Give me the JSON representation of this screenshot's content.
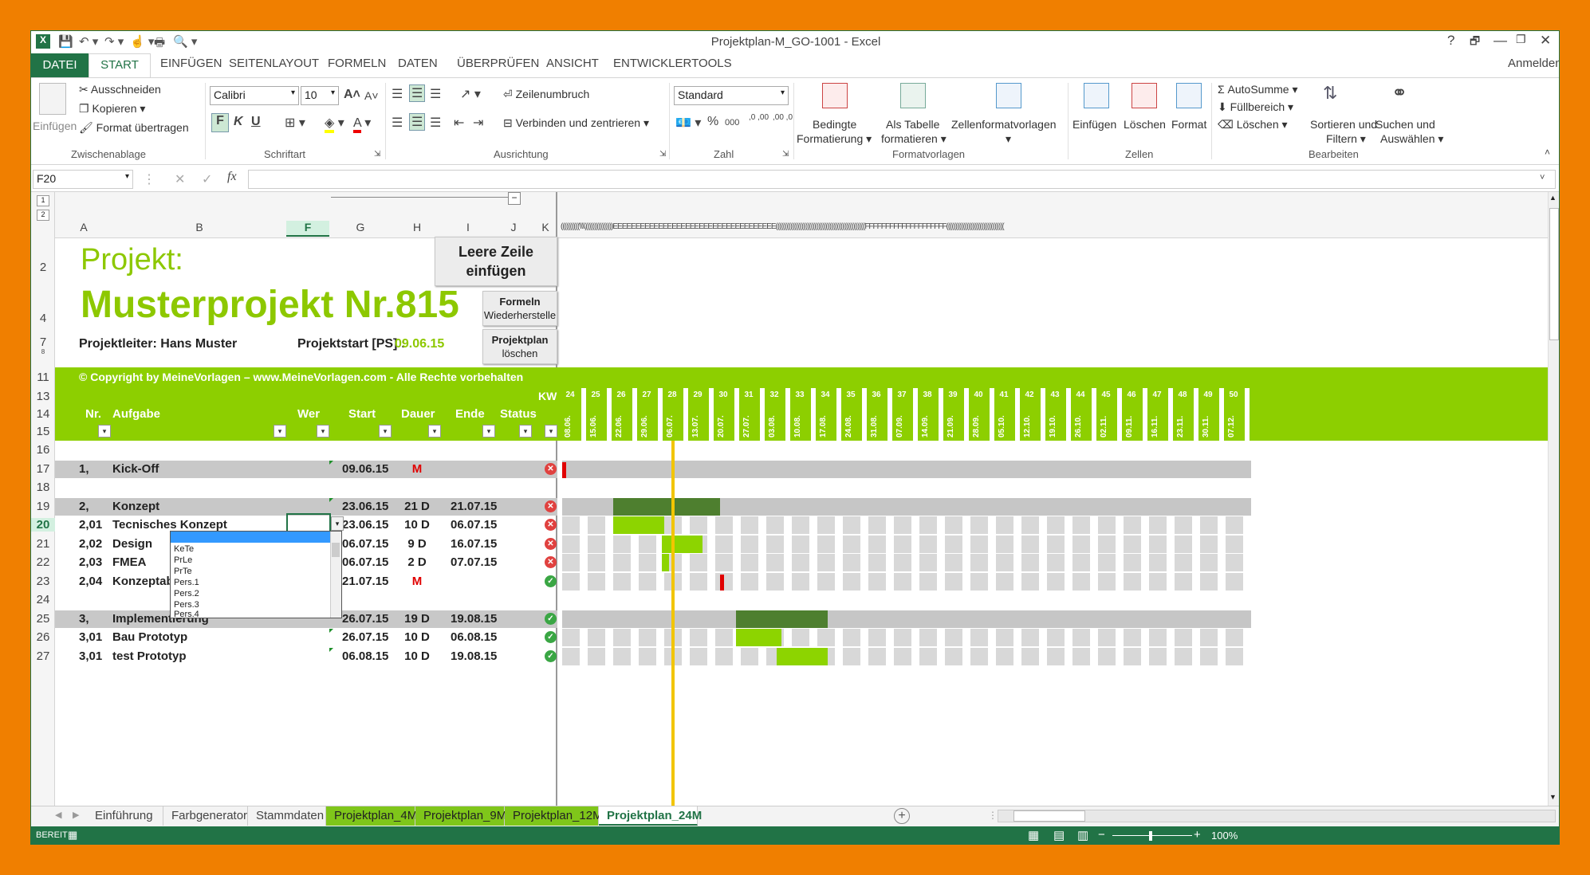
{
  "title": "Projektplan-M_GO-1001 - Excel",
  "window": {
    "help": "?",
    "restore": "🗗",
    "minimize": "🗕",
    "maximize": "🗖",
    "close": "✕"
  },
  "tabs": {
    "file": "DATEI",
    "start": "START",
    "items": [
      "EINFÜGEN",
      "SEITENLAYOUT",
      "FORMELN",
      "DATEN",
      "ÜBERPRÜFEN",
      "ANSICHT",
      "ENTWICKLERTOOLS"
    ],
    "signin": "Anmelden"
  },
  "ribbon": {
    "paste": "Einfügen",
    "cut": "Ausschneiden",
    "copy": "Kopieren",
    "format_painter": "Format übertragen",
    "g_clipboard": "Zwischenablage",
    "font": "Calibri",
    "size": "10",
    "g_font": "Schriftart",
    "bold": "F",
    "italic": "K",
    "underline": "U",
    "wrap": "Zeilenumbruch",
    "merge": "Verbinden und zentrieren",
    "g_align": "Ausrichtung",
    "numfmt": "Standard",
    "g_number": "Zahl",
    "pct": "%",
    "thousand": "000",
    "inc_dec": ",0 ,00",
    "dec_dec": ",00 ,0",
    "cond": "Bedingte",
    "cond2": "Formatierung",
    "astable": "Als Tabelle",
    "astable2": "formatieren",
    "cellstyles": "Zellenformatvorlagen",
    "g_styles": "Formatvorlagen",
    "insert": "Einfügen",
    "delete": "Löschen",
    "format": "Format",
    "g_cells": "Zellen",
    "autosum": "AutoSumme",
    "fill": "Füllbereich",
    "clear": "Löschen",
    "sort": "Sortieren und",
    "sort2": "Filtern",
    "find": "Suchen und",
    "find2": "Auswählen",
    "g_edit": "Bearbeiten"
  },
  "formula": {
    "namebox": "F20",
    "fx": "fx",
    "cancel": "✕",
    "confirm": "✓",
    "value": ""
  },
  "cols": [
    "A",
    "B",
    "F",
    "G",
    "H",
    "I",
    "J",
    "K"
  ],
  "outline": [
    "1",
    "2"
  ],
  "sheet": {
    "proj_label": "Projekt:",
    "proj_name": "Musterprojekt Nr.815",
    "leader": "Projektleiter: Hans Muster",
    "start_label": "Projektstart [PS] :",
    "start_val": "09.06.15",
    "btn_empty": "Leere Zeile",
    "btn_empty2": "einfügen",
    "btn_formulas": "Formeln",
    "btn_formulas2": "Wiederherstelle",
    "btn_clear": "Projektplan",
    "btn_clear2": "löschen",
    "copyright": "© Copyright by MeineVorlagen – www.MeineVorlagen.com - Alle Rechte vorbehalten",
    "h_nr": "Nr.",
    "h_task": "Aufgabe",
    "h_who": "Wer",
    "h_start": "Start",
    "h_dur": "Dauer",
    "h_end": "Ende",
    "h_status": "Status",
    "kw": "KW",
    "colcodes": "((((((((((\\\\\\\\)))))))))))))))EEEEEEEEEEEEEEEEEEEEEEEEEEEEEEEEEEEE((((((((((((((((((((((((((((((((((((((((((((((((FFFFFFFFFFFFFFFFFFFF((((((((((((((((((((((((((((((("
  },
  "weeks": [
    {
      "kw": "24",
      "d": "08.06."
    },
    {
      "kw": "25",
      "d": "15.06."
    },
    {
      "kw": "26",
      "d": "22.06."
    },
    {
      "kw": "27",
      "d": "29.06."
    },
    {
      "kw": "28",
      "d": "06.07."
    },
    {
      "kw": "29",
      "d": "13.07."
    },
    {
      "kw": "30",
      "d": "20.07."
    },
    {
      "kw": "31",
      "d": "27.07."
    },
    {
      "kw": "32",
      "d": "03.08."
    },
    {
      "kw": "33",
      "d": "10.08."
    },
    {
      "kw": "34",
      "d": "17.08."
    },
    {
      "kw": "35",
      "d": "24.08."
    },
    {
      "kw": "36",
      "d": "31.08."
    },
    {
      "kw": "37",
      "d": "07.09."
    },
    {
      "kw": "38",
      "d": "14.09."
    },
    {
      "kw": "39",
      "d": "21.09."
    },
    {
      "kw": "40",
      "d": "28.09."
    },
    {
      "kw": "41",
      "d": "05.10."
    },
    {
      "kw": "42",
      "d": "12.10."
    },
    {
      "kw": "43",
      "d": "19.10."
    },
    {
      "kw": "44",
      "d": "26.10."
    },
    {
      "kw": "45",
      "d": "02.11."
    },
    {
      "kw": "46",
      "d": "09.11."
    },
    {
      "kw": "47",
      "d": "16.11."
    },
    {
      "kw": "48",
      "d": "23.11."
    },
    {
      "kw": "49",
      "d": "30.11."
    },
    {
      "kw": "50",
      "d": "07.12."
    }
  ],
  "rows": [
    {
      "rn": "16"
    },
    {
      "rn": "17",
      "nr": "1,",
      "task": "Kick-Off",
      "start": "09.06.15",
      "dur": "M",
      "end": "",
      "status": "x",
      "band": true,
      "gantt": {
        "type": "milestone",
        "w": 0
      }
    },
    {
      "rn": "18"
    },
    {
      "rn": "19",
      "nr": "2,",
      "task": "Konzept",
      "start": "23.06.15",
      "dur": "21 D",
      "end": "21.07.15",
      "status": "x",
      "band": true,
      "gantt": {
        "type": "summary",
        "w": 2,
        "len": 4.2
      }
    },
    {
      "rn": "20",
      "nr": "2,01",
      "task": "Tecnisches Konzept",
      "start": "23.06.15",
      "dur": "10 D",
      "end": "06.07.15",
      "status": "x",
      "gantt": {
        "type": "task",
        "w": 2,
        "len": 2
      }
    },
    {
      "rn": "21",
      "nr": "2,02",
      "task": "Design",
      "start": "06.07.15",
      "dur": "9 D",
      "end": "16.07.15",
      "status": "x",
      "gantt": {
        "type": "task",
        "w": 3.9,
        "len": 1.6
      }
    },
    {
      "rn": "22",
      "nr": "2,03",
      "task": "FMEA",
      "start": "06.07.15",
      "dur": "2 D",
      "end": "07.07.15",
      "status": "x",
      "gantt": {
        "type": "task",
        "w": 3.9,
        "len": 0.3
      }
    },
    {
      "rn": "23",
      "nr": "2,04",
      "task": "Konzeptabnahme",
      "start": "21.07.15",
      "dur": "M",
      "end": "",
      "status": "ok",
      "gantt": {
        "type": "milestone",
        "w": 6.2
      }
    },
    {
      "rn": "24"
    },
    {
      "rn": "25",
      "nr": "3,",
      "task": "Implementierung",
      "start": "26.07.15",
      "dur": "19 D",
      "end": "19.08.15",
      "status": "ok",
      "band": true,
      "gantt": {
        "type": "summary",
        "w": 6.8,
        "len": 3.6
      }
    },
    {
      "rn": "26",
      "nr": "3,01",
      "task": "Bau Prototyp",
      "start": "26.07.15",
      "dur": "10 D",
      "end": "06.08.15",
      "status": "ok",
      "gantt": {
        "type": "task",
        "w": 6.8,
        "len": 1.8
      }
    },
    {
      "rn": "27",
      "nr": "3,01",
      "task": "test Prototyp",
      "start": "06.08.15",
      "dur": "10 D",
      "end": "19.08.15",
      "status": "ok",
      "gantt": {
        "type": "task",
        "w": 8.4,
        "len": 2
      }
    }
  ],
  "dropdown": [
    "KeTe",
    "PrLe",
    "PrTe",
    "Pers.1",
    "Pers.2",
    "Pers.3",
    "Pers.4"
  ],
  "sheettabs": [
    "Einführung",
    "Farbgenerator",
    "Stammdaten",
    "Projektplan_4M",
    "Projektplan_9M",
    "Projektplan_12M",
    "Projektplan_24M"
  ],
  "statusbar": {
    "mode": "BEREIT",
    "zoom": "100%"
  },
  "colors": {
    "accent": "#217346",
    "header_green": "#8dcf00",
    "bar_light": "#8dd400",
    "bar_dark": "#4e7f2f",
    "today": "#f2c500",
    "milestone": "#e00000"
  }
}
